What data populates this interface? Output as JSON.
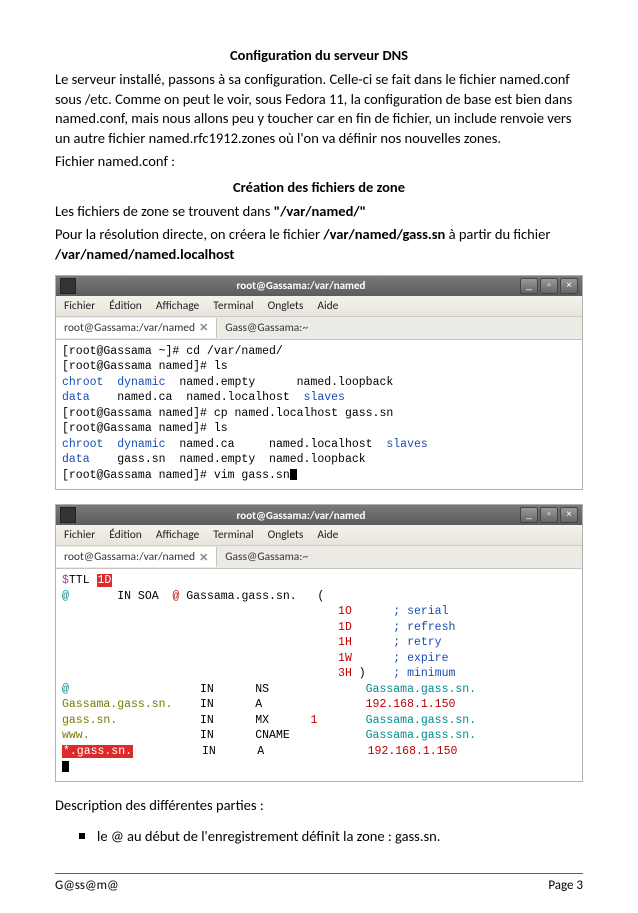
{
  "heading1": "Configuration du serveur DNS",
  "para1": "Le serveur installé, passons à sa configuration. Celle-ci se fait dans le fichier named.conf sous /etc. Comme on peut le voir, sous Fedora 11, la configuration de base est bien dans named.conf, mais nous allons peu y toucher car en fin de fichier, un include renvoie vers un autre fichier named.rfc1912.zones où l'on va définir nos nouvelles zones.",
  "para1b": "Fichier named.conf :",
  "heading2": "Création des fichiers de zone",
  "para2a": "Les fichiers de zone se trouvent dans ",
  "para2a_bold": "\"/var/named/\"",
  "para2b": "Pour la résolution directe, on créera le fichier ",
  "para2b_bold": "/var/named/gass.sn",
  "para2b_after": " à partir du fichier ",
  "para2b_bold2": "/var/named/named.localhost",
  "window1": {
    "title": "root@Gassama:/var/named",
    "menu": [
      "Fichier",
      "Édition",
      "Affichage",
      "Terminal",
      "Onglets",
      "Aide"
    ],
    "tab_active": "root@Gassama:/var/named",
    "tab_inactive": "Gass@Gassama:~",
    "lines": [
      {
        "plain": "[root@Gassama ~]# cd /var/named/"
      },
      {
        "plain": "[root@Gassama named]# ls"
      },
      {
        "segs": [
          {
            "t": "chroot  dynamic",
            "c": "c-blue"
          },
          {
            "t": "  named.empty      named.loopback"
          }
        ]
      },
      {
        "segs": [
          {
            "t": "data",
            "c": "c-blue"
          },
          {
            "t": "    named.ca  named.localhost  "
          },
          {
            "t": "slaves",
            "c": "c-blue"
          }
        ]
      },
      {
        "plain": "[root@Gassama named]# cp named.localhost gass.sn"
      },
      {
        "plain": "[root@Gassama named]# ls"
      },
      {
        "segs": [
          {
            "t": "chroot  dynamic",
            "c": "c-blue"
          },
          {
            "t": "  named.ca     named.localhost  "
          },
          {
            "t": "slaves",
            "c": "c-blue"
          }
        ]
      },
      {
        "segs": [
          {
            "t": "data",
            "c": "c-blue"
          },
          {
            "t": "    gass.sn  named.empty  named.loopback"
          }
        ]
      },
      {
        "segs": [
          {
            "t": "[root@Gassama named]# vim gass.sn"
          },
          {
            "cursor": true
          }
        ]
      }
    ]
  },
  "window2": {
    "title": "root@Gassama:/var/named",
    "menu": [
      "Fichier",
      "Édition",
      "Affichage",
      "Terminal",
      "Onglets",
      "Aide"
    ],
    "tab_active": "root@Gassama:/var/named",
    "tab_inactive": "Gass@Gassama:~",
    "lines": [
      {
        "segs": [
          {
            "t": "$",
            "c": "c-mag"
          },
          {
            "t": "TTL "
          },
          {
            "t": "1D",
            "sel": true
          }
        ]
      },
      {
        "segs": [
          {
            "t": "@",
            "c": "c-teal"
          },
          {
            "t": "       IN SOA  "
          },
          {
            "t": "@",
            "c": "c-red"
          },
          {
            "t": " Gassama.gass.sn.   ("
          }
        ]
      },
      {
        "segs": [
          {
            "pad": "                                        "
          },
          {
            "t": "1O",
            "c": "c-red"
          },
          {
            "t": "      ; serial",
            "c": "c-blue"
          }
        ]
      },
      {
        "segs": [
          {
            "pad": "                                        "
          },
          {
            "t": "1D",
            "c": "c-red"
          },
          {
            "t": "      ; refresh",
            "c": "c-blue"
          }
        ]
      },
      {
        "segs": [
          {
            "pad": "                                        "
          },
          {
            "t": "1H",
            "c": "c-red"
          },
          {
            "t": "      ; retry",
            "c": "c-blue"
          }
        ]
      },
      {
        "segs": [
          {
            "pad": "                                        "
          },
          {
            "t": "1W",
            "c": "c-red"
          },
          {
            "t": "      ; expire",
            "c": "c-blue"
          }
        ]
      },
      {
        "segs": [
          {
            "pad": "                                        "
          },
          {
            "t": "3H",
            "c": "c-red"
          },
          {
            "t": " )    "
          },
          {
            "t": "; minimum",
            "c": "c-blue"
          }
        ]
      },
      {
        "segs": [
          {
            "t": "@",
            "c": "c-teal"
          },
          {
            "t": "                   IN      NS              "
          },
          {
            "t": "Gassama.gass.sn.",
            "c": "c-teal"
          }
        ]
      },
      {
        "segs": [
          {
            "t": "Gassama.gass.sn.",
            "c": "c-olive"
          },
          {
            "t": "    IN      A               "
          },
          {
            "t": "192.168.1.150",
            "c": "c-red"
          }
        ]
      },
      {
        "segs": [
          {
            "t": "gass.sn.",
            "c": "c-olive"
          },
          {
            "t": "            IN      MX      "
          },
          {
            "t": "1",
            "c": "c-red"
          },
          {
            "t": "       "
          },
          {
            "t": "Gassama.gass.sn.",
            "c": "c-teal"
          }
        ]
      },
      {
        "segs": [
          {
            "t": "www.",
            "c": "c-olive"
          },
          {
            "t": "                IN      CNAME           "
          },
          {
            "t": "Gassama.gass.sn.",
            "c": "c-teal"
          }
        ]
      },
      {
        "segs": [
          {
            "t": "*.gass.sn.",
            "sel": true
          },
          {
            "t": "          IN      A               "
          },
          {
            "t": "192.168.1.150",
            "c": "c-red"
          }
        ]
      },
      {
        "segs": [
          {
            "cursor": true
          }
        ]
      }
    ]
  },
  "para3": "Description des différentes parties :",
  "bullet1": "le @ au début de l'enregistrement définit la zone : gass.sn.",
  "footer_left": "G@ss@m@",
  "footer_right": "Page 3"
}
